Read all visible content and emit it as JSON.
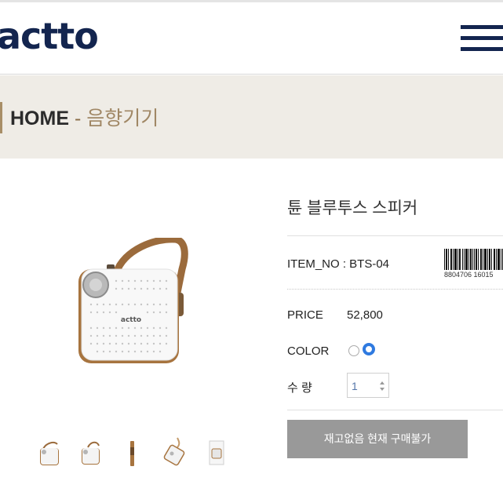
{
  "header": {
    "logo_text": "actto",
    "menu_icon": "hamburger-menu-icon",
    "brand_color": "#13254f"
  },
  "breadcrumb": {
    "home": "HOME",
    "separator": " - ",
    "current": "음향기기"
  },
  "product": {
    "title": "튠 블루투스 스피커",
    "item_no_label": "ITEM_NO : BTS-04",
    "barcode_number": "8804706 16015",
    "price_label": "PRICE",
    "price_value": "52,800",
    "color_label": "COLOR",
    "color_options": [
      {
        "name": "option-1",
        "selected": false
      },
      {
        "name": "option-2",
        "selected": true
      }
    ],
    "quantity_label": "수 량",
    "quantity_value": "1",
    "buy_button_label": "재고없음 현재 구매불가",
    "thumbnail_count": 5
  }
}
